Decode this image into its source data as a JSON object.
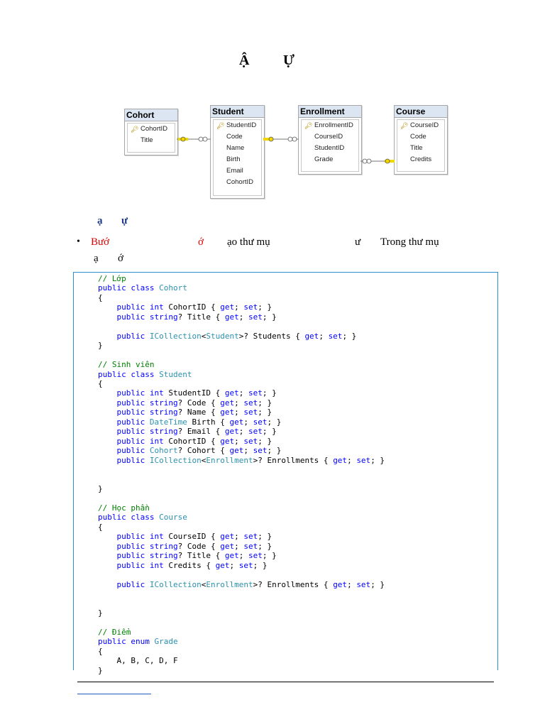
{
  "title": {
    "part1": "Ậ",
    "part2": "Ự"
  },
  "diagram": {
    "tables": [
      {
        "name": "Cohort",
        "columns": [
          "CohortID",
          "Title"
        ],
        "key": "CohortID"
      },
      {
        "name": "Student",
        "columns": [
          "StudentID",
          "Code",
          "Name",
          "Birth",
          "Email",
          "CohortID"
        ],
        "key": "StudentID"
      },
      {
        "name": "Enrollment",
        "columns": [
          "EnrollmentID",
          "CourseID",
          "StudentID",
          "Grade"
        ],
        "key": "EnrollmentID"
      },
      {
        "name": "Course",
        "columns": [
          "CourseID",
          "Code",
          "Title",
          "Credits"
        ],
        "key": "CourseID"
      }
    ],
    "key_icon": "key-icon",
    "relationship_icon": "relationship-connector-icon"
  },
  "section": {
    "part1": "ạ",
    "part2": "ự"
  },
  "step": {
    "bullet": "•",
    "label": "Bướ",
    "mark": "ớ",
    "text1": "ạo thư mụ",
    "text2": "ư",
    "text3": "Trong thư mụ"
  },
  "step2": {
    "part1": "ạ",
    "part2": "ớ"
  },
  "code": {
    "language": "C#",
    "comments": [
      "// Lớp",
      "// Sinh viên",
      "// Học phần",
      "// Điểm"
    ],
    "classes": [
      "Cohort",
      "Student",
      "Course"
    ],
    "enum": "Grade",
    "enum_values": "A, B, C, D, F"
  },
  "colors": {
    "heading_blue": "#1f3c88",
    "step_red": "#e00000",
    "code_keyword": "#0000ff",
    "code_type": "#2b91af",
    "code_comment": "#008000",
    "codebox_border": "#2b91c8"
  }
}
